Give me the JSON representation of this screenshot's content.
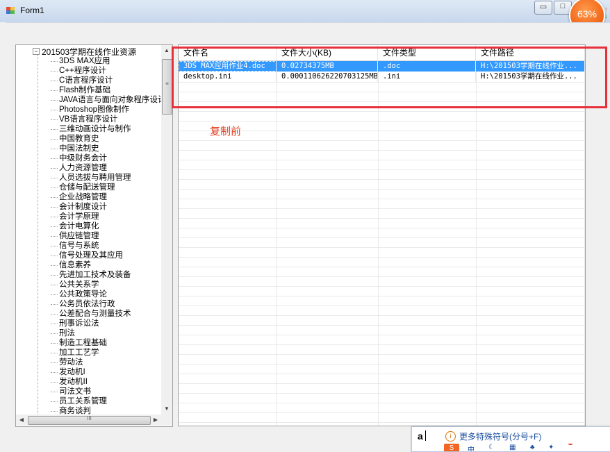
{
  "window": {
    "title": "Form1",
    "usage_badge": "63%",
    "controls": {
      "minimize": "▭",
      "maximize": "□"
    }
  },
  "tree": {
    "root": "201503学期在线作业资源",
    "root_expander": "−",
    "items": [
      "3DS MAX应用",
      "C++程序设计",
      "C语言程序设计",
      "Flash制作基础",
      "JAVA语言与面向对象程序设计",
      "Photoshop图像制作",
      "VB语言程序设计",
      "三维动画设计与制作",
      "中国教育史",
      "中国法制史",
      "中级财务会计",
      "人力资源管理",
      "人员选拔与聘用管理",
      "仓储与配送管理",
      "企业战略管理",
      "会计制度设计",
      "会计学原理",
      "会计电算化",
      "供应链管理",
      "信号与系统",
      "信号处理及其应用",
      "信息素养",
      "先进加工技术及装备",
      "公共关系学",
      "公共政策导论",
      "公务员依法行政",
      "公差配合与测量技术",
      "刑事诉讼法",
      "刑法",
      "制造工程基础",
      "加工工艺学",
      "劳动法",
      "发动机I",
      "发动机II",
      "司法文书",
      "员工关系管理",
      "商务谈判"
    ],
    "scroll_grip": "≡",
    "hscroll_grip": "III"
  },
  "file_list": {
    "columns": [
      "文件名",
      "文件大小(KB)",
      "文件类型",
      "文件路径"
    ],
    "rows": [
      [
        "3DS MAX应用作业4.doc",
        "0.02734375MB",
        ".doc",
        "H:\\201503学期在线作业..."
      ],
      [
        "desktop.ini",
        "0.000110626220703125MB",
        ".ini",
        "H:\\201503学期在线作业..."
      ]
    ],
    "selected_row": 0
  },
  "annotation": {
    "caption": "复制前",
    "highlight_color": "#e8303a"
  },
  "ime": {
    "input": "a",
    "hint": "更多特殊符号(分号+F)",
    "info_icon": "i",
    "logo": "S",
    "bar_char": "中"
  },
  "colors": {
    "selection": "#3399ff",
    "caption": "#e43d1d",
    "badge": "#f26a1b"
  }
}
